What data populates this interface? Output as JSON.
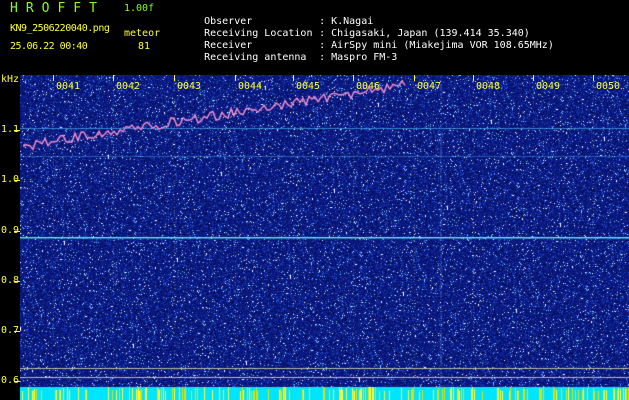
{
  "app": {
    "title": "HROFFT",
    "version": "1.00f"
  },
  "file": {
    "name": "KN9_2506220040.png",
    "datetime": "25.06.22 00:40"
  },
  "meteor": {
    "label": "meteor",
    "count": "81"
  },
  "info": [
    {
      "key": "Observer",
      "value": "K.Nagai"
    },
    {
      "key": "Receiving Location",
      "value": "Chigasaki, Japan (139.414 35.340)"
    },
    {
      "key": "Receiver",
      "value": "AirSpy mini (Miakejima VOR 108.65MHz)"
    },
    {
      "key": "Receiving antenna",
      "value": "Maspro FM-3"
    }
  ],
  "axes": {
    "y_unit": "kHz",
    "y_ticks": [
      "1.1",
      "1.0",
      "0.9",
      "0.8",
      "0.7",
      "0.6"
    ],
    "x_ticks": [
      "0041",
      "0042",
      "0043",
      "0044",
      "0045",
      "0046",
      "0047",
      "0048",
      "0049",
      "0050"
    ]
  },
  "colors": {
    "background": "#0a1880",
    "label": "#ffff33",
    "title": "#7fff2a"
  }
}
